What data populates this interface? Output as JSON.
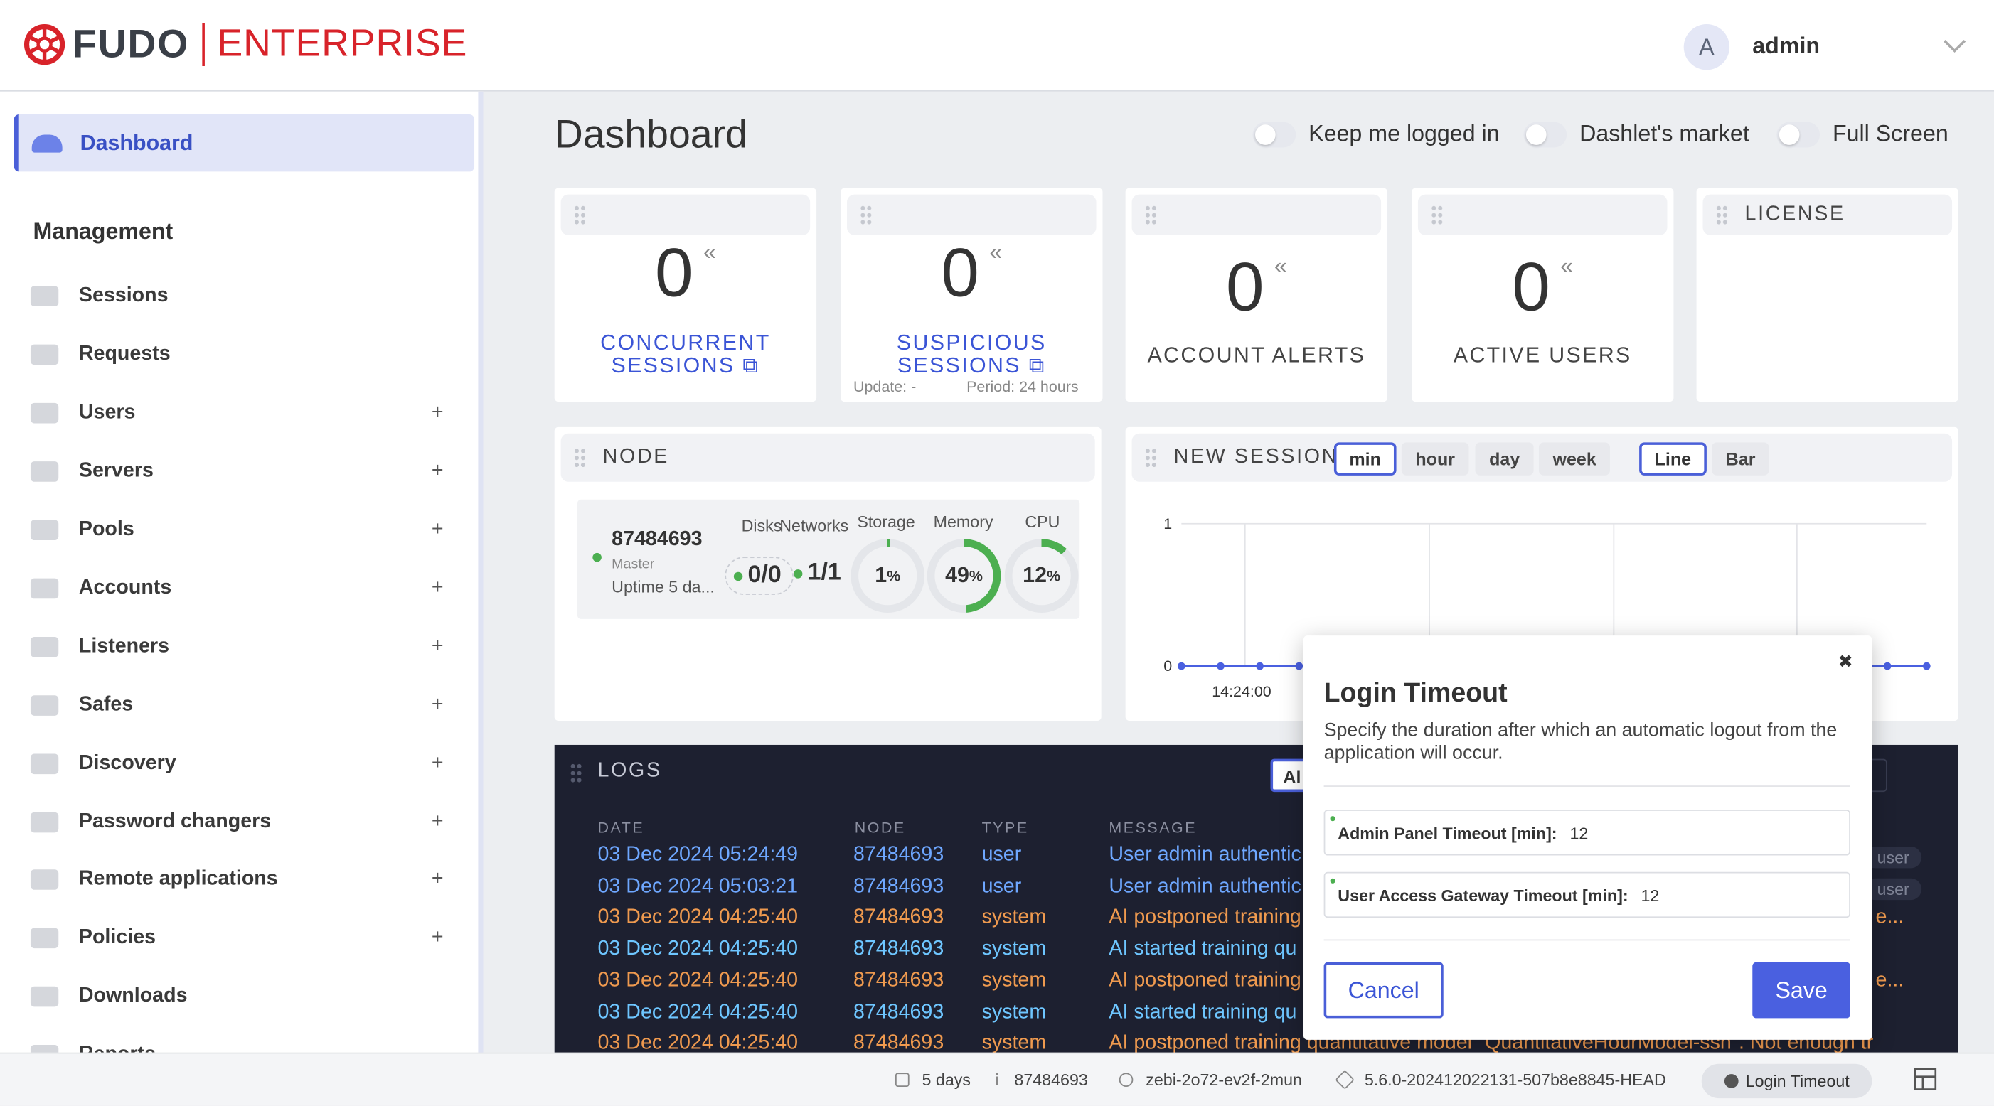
{
  "brand": {
    "name": "FUDO",
    "edition": "ENTERPRISE"
  },
  "user": {
    "initial": "A",
    "name": "admin"
  },
  "sidebar": {
    "active": {
      "label": "Dashboard"
    },
    "section_title": "Management",
    "items": [
      {
        "label": "Sessions",
        "expand": ""
      },
      {
        "label": "Requests",
        "expand": ""
      },
      {
        "label": "Users",
        "expand": "+"
      },
      {
        "label": "Servers",
        "expand": "+"
      },
      {
        "label": "Pools",
        "expand": "+"
      },
      {
        "label": "Accounts",
        "expand": "+"
      },
      {
        "label": "Listeners",
        "expand": "+"
      },
      {
        "label": "Safes",
        "expand": "+"
      },
      {
        "label": "Discovery",
        "expand": "+"
      },
      {
        "label": "Password changers",
        "expand": "+"
      },
      {
        "label": "Remote applications",
        "expand": "+"
      },
      {
        "label": "Policies",
        "expand": "+"
      },
      {
        "label": "Downloads",
        "expand": ""
      },
      {
        "label": "Reports",
        "expand": ""
      }
    ]
  },
  "page": {
    "title": "Dashboard"
  },
  "toggles": {
    "keep_logged": "Keep me logged in",
    "dashlet_market": "Dashlet's market",
    "full_screen": "Full Screen"
  },
  "stats": {
    "concurrent": {
      "value": "0",
      "label1": "CONCURRENT",
      "label2": "SESSIONS"
    },
    "suspicious": {
      "value": "0",
      "label1": "SUSPICIOUS",
      "label2": "SESSIONS",
      "update": "Update: -",
      "period": "Period: 24 hours"
    },
    "alerts": {
      "value": "0",
      "label": "ACCOUNT ALERTS"
    },
    "active_users": {
      "value": "0",
      "label": "ACTIVE USERS"
    },
    "license": {
      "title": "LICENSE"
    }
  },
  "node": {
    "title": "NODE",
    "id": "87484693",
    "role": "Master",
    "uptime": "Uptime 5 da...",
    "col_disks": "Disks",
    "col_networks": "Networks",
    "col_storage": "Storage",
    "col_memory": "Memory",
    "col_cpu": "CPU",
    "disks": "0/0",
    "networks": "1/1",
    "storage": "1",
    "storage_pct": 1,
    "memory": "49",
    "memory_pct": 49,
    "cpu": "12",
    "cpu_pct": 12,
    "pct": "%"
  },
  "new_sessions": {
    "title": "NEW SESSIONS",
    "ranges": [
      "min",
      "hour",
      "day",
      "week"
    ],
    "active_range": "min",
    "types": [
      "Line",
      "Bar"
    ],
    "active_type": "Line",
    "chart_data": {
      "type": "line",
      "title": "NEW SESSIONS",
      "x_tick_visible": "14:24:00",
      "ylim": [
        0,
        1
      ],
      "y_ticks": [
        "0",
        "1"
      ],
      "series": [
        {
          "values": [
            0,
            0,
            0,
            0,
            0,
            0,
            0,
            0,
            0,
            0,
            0,
            0,
            0,
            0,
            0,
            0,
            0,
            0,
            0,
            0
          ]
        }
      ],
      "grid": true
    }
  },
  "logs": {
    "title": "LOGS",
    "filter_label": "Al",
    "columns": [
      "DATE",
      "NODE",
      "TYPE",
      "MESSAGE"
    ],
    "rows": [
      {
        "date": "03 Dec 2024 05:24:49",
        "node": "87484693",
        "type": "user",
        "message": "User admin authentic",
        "tail": "user"
      },
      {
        "date": "03 Dec 2024 05:03:21",
        "node": "87484693",
        "type": "user",
        "message": "User admin authentic",
        "tail": "user"
      },
      {
        "date": "03 Dec 2024 04:25:40",
        "node": "87484693",
        "type": "system",
        "message": "AI postponed training",
        "tail": "t e..."
      },
      {
        "date": "03 Dec 2024 04:25:40",
        "node": "87484693",
        "type": "system",
        "message": "AI started training qu",
        "tail": ""
      },
      {
        "date": "03 Dec 2024 04:25:40",
        "node": "87484693",
        "type": "system",
        "message": "AI postponed training",
        "tail": "t e..."
      },
      {
        "date": "03 Dec 2024 04:25:40",
        "node": "87484693",
        "type": "system",
        "message": "AI started training qu",
        "tail": ""
      },
      {
        "date": "03 Dec 2024 04:25:40",
        "node": "87484693",
        "type": "system",
        "message": "AI postponed training quantitative model \"QuantitativeHourModel-ssh\". Not enough tr",
        "tail": ""
      }
    ]
  },
  "modal": {
    "title": "Login Timeout",
    "description": "Specify the duration after which an automatic logout from the application will occur.",
    "admin_label": "Admin Panel Timeout [min]:",
    "admin_value": "12",
    "gateway_label": "User Access Gateway Timeout [min]:",
    "gateway_value": "12",
    "cancel": "Cancel",
    "save": "Save",
    "close": "✖"
  },
  "footer": {
    "uptime": "5 days",
    "node": "87484693",
    "host": "zebi-2o72-ev2f-2mun",
    "version": "5.6.0-202412022131-507b8e8845-HEAD",
    "login_timeout": "Login Timeout"
  },
  "colors": {
    "accent": "#4a5fd8",
    "brand_red": "#d8232a",
    "log_bg": "#1d2030",
    "ok": "#4caf50"
  }
}
